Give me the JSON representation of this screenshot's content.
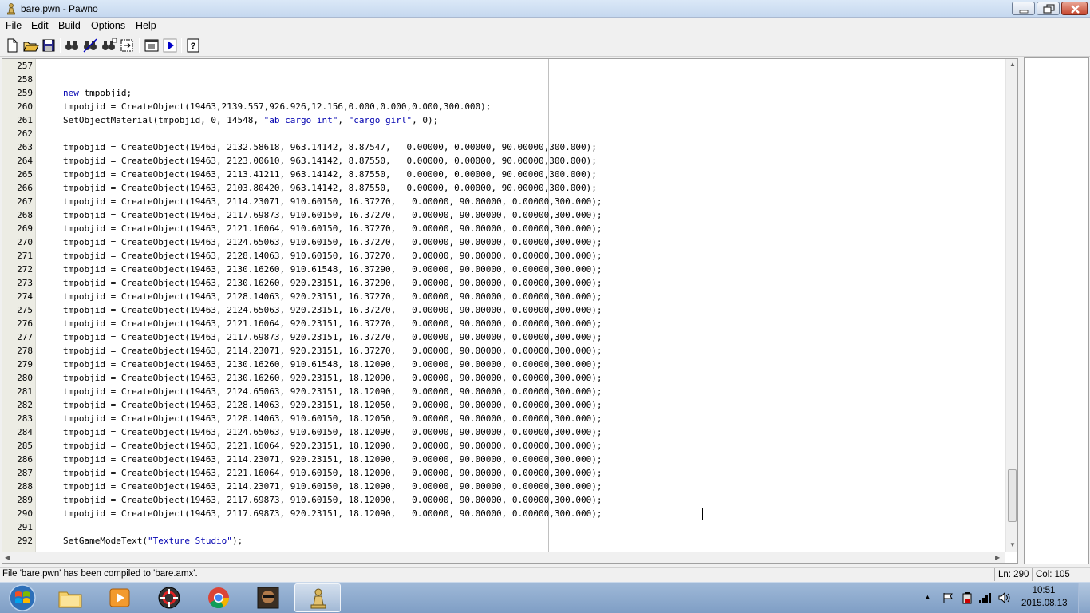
{
  "window": {
    "title": "bare.pwn - Pawno"
  },
  "menu": {
    "file": "File",
    "edit": "Edit",
    "build": "Build",
    "options": "Options",
    "help": "Help"
  },
  "toolbar": {
    "icons": [
      "new-file-icon",
      "open-folder-icon",
      "save-icon",
      "find-icon",
      "find-next-icon",
      "replace-icon",
      "goto-icon",
      "compile-run-icon",
      "play-icon",
      "help-icon"
    ]
  },
  "editor": {
    "lines": [
      {
        "n": "257",
        "code": ""
      },
      {
        "n": "258",
        "code": ""
      },
      {
        "n": "259",
        "kw": "new",
        "code": " tmpobjid;"
      },
      {
        "n": "260",
        "code": "tmpobjid = CreateObject(19463,2139.557,926.926,12.156,0.000,0.000,0.000,300.000);"
      },
      {
        "n": "261",
        "code": "SetObjectMaterial(tmpobjid, 0, 14548, ",
        "s1": "\"ab_cargo_int\"",
        "mid": ", ",
        "s2": "\"cargo_girl\"",
        "tail": ", 0);"
      },
      {
        "n": "262",
        "code": ""
      },
      {
        "n": "263",
        "code": "tmpobjid = CreateObject(19463, 2132.58618, 963.14142, 8.87547,   0.00000, 0.00000, 90.00000,300.000);"
      },
      {
        "n": "264",
        "code": "tmpobjid = CreateObject(19463, 2123.00610, 963.14142, 8.87550,   0.00000, 0.00000, 90.00000,300.000);"
      },
      {
        "n": "265",
        "code": "tmpobjid = CreateObject(19463, 2113.41211, 963.14142, 8.87550,   0.00000, 0.00000, 90.00000,300.000);"
      },
      {
        "n": "266",
        "code": "tmpobjid = CreateObject(19463, 2103.80420, 963.14142, 8.87550,   0.00000, 0.00000, 90.00000,300.000);"
      },
      {
        "n": "267",
        "code": "tmpobjid = CreateObject(19463, 2114.23071, 910.60150, 16.37270,   0.00000, 90.00000, 0.00000,300.000);"
      },
      {
        "n": "268",
        "code": "tmpobjid = CreateObject(19463, 2117.69873, 910.60150, 16.37270,   0.00000, 90.00000, 0.00000,300.000);"
      },
      {
        "n": "269",
        "code": "tmpobjid = CreateObject(19463, 2121.16064, 910.60150, 16.37270,   0.00000, 90.00000, 0.00000,300.000);"
      },
      {
        "n": "270",
        "code": "tmpobjid = CreateObject(19463, 2124.65063, 910.60150, 16.37270,   0.00000, 90.00000, 0.00000,300.000);"
      },
      {
        "n": "271",
        "code": "tmpobjid = CreateObject(19463, 2128.14063, 910.60150, 16.37270,   0.00000, 90.00000, 0.00000,300.000);"
      },
      {
        "n": "272",
        "code": "tmpobjid = CreateObject(19463, 2130.16260, 910.61548, 16.37290,   0.00000, 90.00000, 0.00000,300.000);"
      },
      {
        "n": "273",
        "code": "tmpobjid = CreateObject(19463, 2130.16260, 920.23151, 16.37290,   0.00000, 90.00000, 0.00000,300.000);"
      },
      {
        "n": "274",
        "code": "tmpobjid = CreateObject(19463, 2128.14063, 920.23151, 16.37270,   0.00000, 90.00000, 0.00000,300.000);"
      },
      {
        "n": "275",
        "code": "tmpobjid = CreateObject(19463, 2124.65063, 920.23151, 16.37270,   0.00000, 90.00000, 0.00000,300.000);"
      },
      {
        "n": "276",
        "code": "tmpobjid = CreateObject(19463, 2121.16064, 920.23151, 16.37270,   0.00000, 90.00000, 0.00000,300.000);"
      },
      {
        "n": "277",
        "code": "tmpobjid = CreateObject(19463, 2117.69873, 920.23151, 16.37270,   0.00000, 90.00000, 0.00000,300.000);"
      },
      {
        "n": "278",
        "code": "tmpobjid = CreateObject(19463, 2114.23071, 920.23151, 16.37270,   0.00000, 90.00000, 0.00000,300.000);"
      },
      {
        "n": "279",
        "code": "tmpobjid = CreateObject(19463, 2130.16260, 910.61548, 18.12090,   0.00000, 90.00000, 0.00000,300.000);"
      },
      {
        "n": "280",
        "code": "tmpobjid = CreateObject(19463, 2130.16260, 920.23151, 18.12090,   0.00000, 90.00000, 0.00000,300.000);"
      },
      {
        "n": "281",
        "code": "tmpobjid = CreateObject(19463, 2124.65063, 920.23151, 18.12090,   0.00000, 90.00000, 0.00000,300.000);"
      },
      {
        "n": "282",
        "code": "tmpobjid = CreateObject(19463, 2128.14063, 920.23151, 18.12050,   0.00000, 90.00000, 0.00000,300.000);"
      },
      {
        "n": "283",
        "code": "tmpobjid = CreateObject(19463, 2128.14063, 910.60150, 18.12050,   0.00000, 90.00000, 0.00000,300.000);"
      },
      {
        "n": "284",
        "code": "tmpobjid = CreateObject(19463, 2124.65063, 910.60150, 18.12090,   0.00000, 90.00000, 0.00000,300.000);"
      },
      {
        "n": "285",
        "code": "tmpobjid = CreateObject(19463, 2121.16064, 920.23151, 18.12090,   0.00000, 90.00000, 0.00000,300.000);"
      },
      {
        "n": "286",
        "code": "tmpobjid = CreateObject(19463, 2114.23071, 920.23151, 18.12090,   0.00000, 90.00000, 0.00000,300.000);"
      },
      {
        "n": "287",
        "code": "tmpobjid = CreateObject(19463, 2121.16064, 910.60150, 18.12090,   0.00000, 90.00000, 0.00000,300.000);"
      },
      {
        "n": "288",
        "code": "tmpobjid = CreateObject(19463, 2114.23071, 910.60150, 18.12090,   0.00000, 90.00000, 0.00000,300.000);"
      },
      {
        "n": "289",
        "code": "tmpobjid = CreateObject(19463, 2117.69873, 910.60150, 18.12090,   0.00000, 90.00000, 0.00000,300.000);"
      },
      {
        "n": "290",
        "code": "tmpobjid = CreateObject(19463, 2117.69873, 920.23151, 18.12090,   0.00000, 90.00000, 0.00000,300.000);"
      },
      {
        "n": "291",
        "code": ""
      },
      {
        "n": "292",
        "code": "SetGameModeText(",
        "s1": "\"Texture Studio\"",
        "tail": ");"
      }
    ]
  },
  "status": {
    "message": "File 'bare.pwn' has been compiled to 'bare.amx'.",
    "line": "Ln: 290",
    "col": "Col: 105"
  },
  "taskbar": {
    "apps": [
      "explorer-icon",
      "media-player-icon",
      "utility-icon",
      "chrome-icon",
      "game-icon",
      "pawno-icon"
    ],
    "clock_time": "10:51",
    "clock_date": "2015.08.13"
  }
}
